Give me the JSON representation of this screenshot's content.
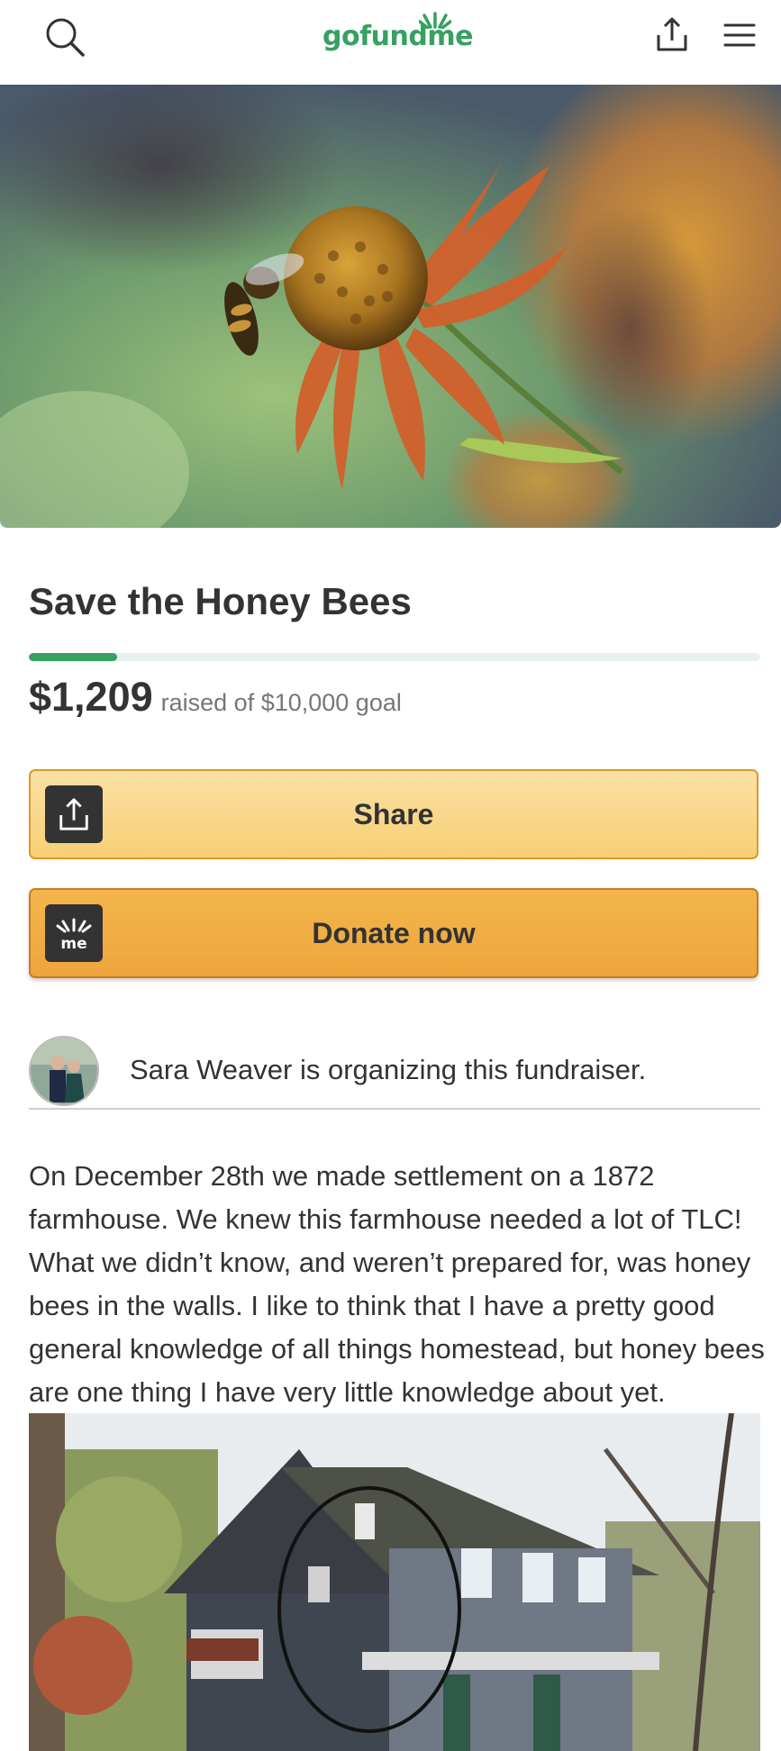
{
  "header": {
    "logo_text": "gofundme",
    "icons": [
      "search-icon",
      "share-icon",
      "menu-icon"
    ],
    "brand_color": "#36a160"
  },
  "hero": {
    "image": "bee-on-orange-flower-photo"
  },
  "campaign": {
    "title": "Save the Honey Bees",
    "raised": "$1,209",
    "goal_text": "raised of $10,000 goal",
    "progress_fraction": 0.1209
  },
  "actions": {
    "share_label": "Share",
    "donate_label": "Donate now",
    "donate_icon_text": "me"
  },
  "organizer": {
    "text": "Sara Weaver is organizing this fundraiser."
  },
  "story": {
    "text": "On December 28th we made settlement on a 1872 farmhouse. We knew this farmhouse needed a lot of TLC! What we didn’t know, and weren’t prepared for, was honey bees in the walls.  I like to think that I have a pretty good general knowledge of all things homestead, but honey bees are one thing I have very little knowledge about yet.",
    "image": "farmhouse-photo-with-circled-wall"
  }
}
